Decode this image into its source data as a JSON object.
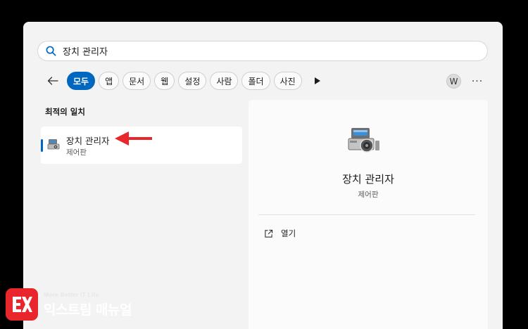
{
  "search": {
    "value": "장치 관리자",
    "icon": "search-icon"
  },
  "filters": {
    "back_icon": "back-arrow-icon",
    "chips": [
      {
        "label": "모두",
        "active": true
      },
      {
        "label": "앱",
        "active": false
      },
      {
        "label": "문서",
        "active": false
      },
      {
        "label": "웹",
        "active": false
      },
      {
        "label": "설정",
        "active": false
      },
      {
        "label": "사람",
        "active": false
      },
      {
        "label": "폴더",
        "active": false
      },
      {
        "label": "사진",
        "active": false
      }
    ],
    "more_filters_icon": "play-icon"
  },
  "account": {
    "avatar_letter": "W",
    "more_label": "···"
  },
  "best_match": {
    "section_title": "최적의 일치",
    "result": {
      "title": "장치 관리자",
      "subtitle": "제어판",
      "icon": "device-manager-icon"
    }
  },
  "detail": {
    "title": "장치 관리자",
    "subtitle": "제어판",
    "icon": "device-manager-icon",
    "actions": [
      {
        "label": "열기",
        "icon": "open-external-icon"
      }
    ]
  },
  "annotation": {
    "arrow_color": "#e8262c"
  },
  "watermark": {
    "tagline": "More Better IT Life",
    "brand": "익스트림 매뉴얼"
  },
  "colors": {
    "accent": "#0067c0",
    "panel": "#f3f3f3",
    "background": "#000000"
  }
}
